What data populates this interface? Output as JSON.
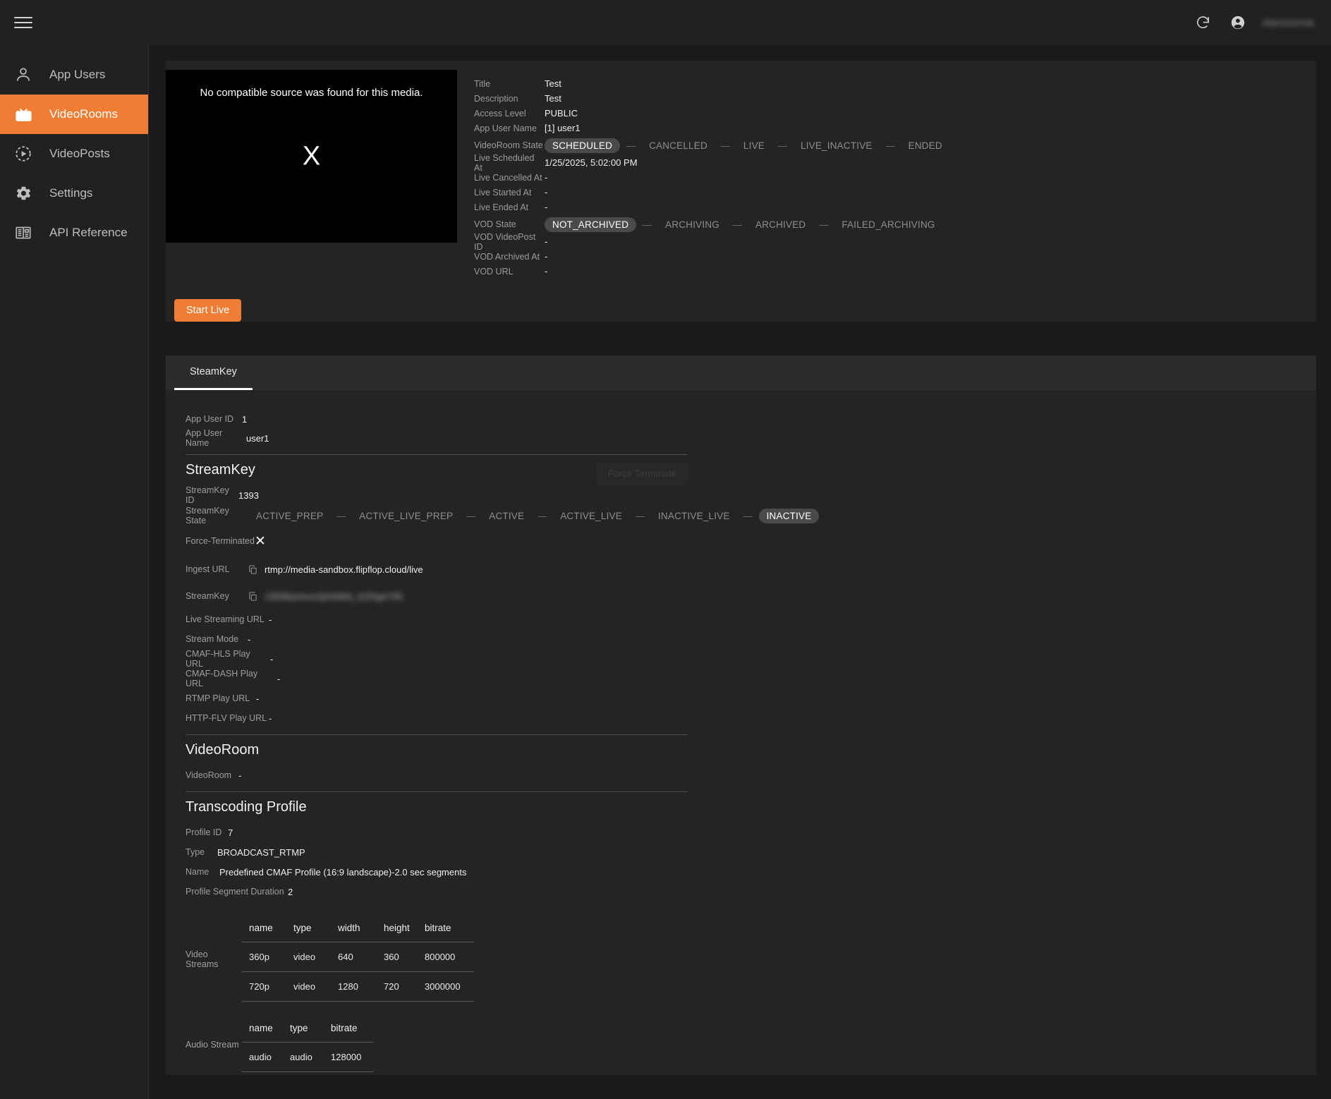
{
  "topbar": {
    "menu_icon": "hamburger-menu-icon",
    "refresh_icon": "refresh-icon",
    "account_icon": "account-circle-icon",
    "username": "danssonia"
  },
  "sidebar": {
    "items": [
      {
        "label": "App Users",
        "icon": "person-icon",
        "active": false,
        "external": false
      },
      {
        "label": "VideoRooms",
        "icon": "tv-play-icon",
        "active": true,
        "external": false
      },
      {
        "label": "VideoPosts",
        "icon": "circle-play-icon",
        "active": false,
        "external": false
      },
      {
        "label": "Settings",
        "icon": "gear-icon",
        "active": false,
        "external": false
      },
      {
        "label": "API Reference",
        "icon": "book-list-icon",
        "active": false,
        "external": true
      }
    ]
  },
  "player": {
    "message": "No compatible source was found for this media.",
    "glyph": "X"
  },
  "details": {
    "title_label": "Title",
    "title_value": "Test",
    "description_label": "Description",
    "description_value": "Test",
    "access_level_label": "Access Level",
    "access_level_value": "PUBLIC",
    "app_user_name_label": "App User Name",
    "app_user_name_value": "[1] user1",
    "videoroom_state_label": "VideoRoom State",
    "videoroom_states": [
      "SCHEDULED",
      "CANCELLED",
      "LIVE",
      "LIVE_INACTIVE",
      "ENDED"
    ],
    "videoroom_state_selected": "SCHEDULED",
    "live_scheduled_at_label": "Live Scheduled At",
    "live_scheduled_at_value": "1/25/2025, 5:02:00 PM",
    "live_cancelled_at_label": "Live Cancelled At",
    "live_cancelled_at_value": "-",
    "live_started_at_label": "Live Started At",
    "live_started_at_value": "-",
    "live_ended_at_label": "Live Ended At",
    "live_ended_at_value": "-",
    "vod_state_label": "VOD State",
    "vod_states": [
      "NOT_ARCHIVED",
      "ARCHIVING",
      "ARCHIVED",
      "FAILED_ARCHIVING"
    ],
    "vod_state_selected": "NOT_ARCHIVED",
    "vod_videopost_id_label": "VOD VideoPost ID",
    "vod_videopost_id_value": "-",
    "vod_archived_at_label": "VOD Archived At",
    "vod_archived_at_value": "-",
    "vod_url_label": "VOD URL",
    "vod_url_value": "-",
    "start_live_button": "Start Live"
  },
  "tabs": [
    {
      "label": "SteamKey",
      "active": true
    }
  ],
  "streamkey_tab": {
    "app_user_id_label": "App User ID",
    "app_user_id_value": "1",
    "app_user_name_label": "App User Name",
    "app_user_name_value": "user1",
    "section_streamkey": "StreamKey",
    "force_terminate_button": "Force Terminate",
    "streamkey_id_label": "StreamKey ID",
    "streamkey_id_value": "1393",
    "streamkey_state_label": "StreamKey State",
    "streamkey_states": [
      "ACTIVE_PREP",
      "ACTIVE_LIVE_PREP",
      "ACTIVE",
      "ACTIVE_LIVE",
      "INACTIVE_LIVE",
      "INACTIVE"
    ],
    "streamkey_state_selected": "INACTIVE",
    "force_terminated_label": "Force-Terminated",
    "force_terminated_value": "✕",
    "ingest_url_label": "Ingest URL",
    "ingest_url_value": "rtmp://media-sandbox.flipflop.cloud/live",
    "streamkey_label": "StreamKey",
    "streamkey_value": "1393kpmxxxQmbbkt_kZGgeYRt",
    "live_streaming_url_label": "Live Streaming URL",
    "live_streaming_url_value": "-",
    "stream_mode_label": "Stream Mode",
    "stream_mode_value": "-",
    "cmaf_hls_label": "CMAF-HLS Play URL",
    "cmaf_hls_value": "-",
    "cmaf_dash_label": "CMAF-DASH Play URL",
    "cmaf_dash_value": "-",
    "rtmp_play_label": "RTMP Play URL",
    "rtmp_play_value": "-",
    "http_flv_label": "HTTP-FLV Play URL",
    "http_flv_value": "-",
    "section_videoroom": "VideoRoom",
    "videoroom_label": "VideoRoom",
    "videoroom_value": "-",
    "section_transcoding": "Transcoding Profile",
    "profile_id_label": "Profile ID",
    "profile_id_value": "7",
    "type_label": "Type",
    "type_value": "BROADCAST_RTMP",
    "name_label": "Name",
    "name_value": "Predefined CMAF Profile (16:9 landscape)-2.0 sec segments",
    "profile_segment_duration_label": "Profile Segment Duration",
    "profile_segment_duration_value": "2",
    "video_streams_label": "Video Streams",
    "video_streams_headers": [
      "name",
      "type",
      "width",
      "height",
      "bitrate"
    ],
    "video_streams_rows": [
      [
        "360p",
        "video",
        "640",
        "360",
        "800000"
      ],
      [
        "720p",
        "video",
        "1280",
        "720",
        "3000000"
      ]
    ],
    "audio_stream_label": "Audio Stream",
    "audio_stream_headers": [
      "name",
      "type",
      "bitrate"
    ],
    "audio_stream_rows": [
      [
        "audio",
        "audio",
        "128000"
      ]
    ]
  },
  "colors": {
    "accent": "#ef7d34",
    "panel": "#242424",
    "background": "#1a1a1a",
    "tabbar": "#2c2c2c",
    "badge": "#4a4a4a"
  }
}
